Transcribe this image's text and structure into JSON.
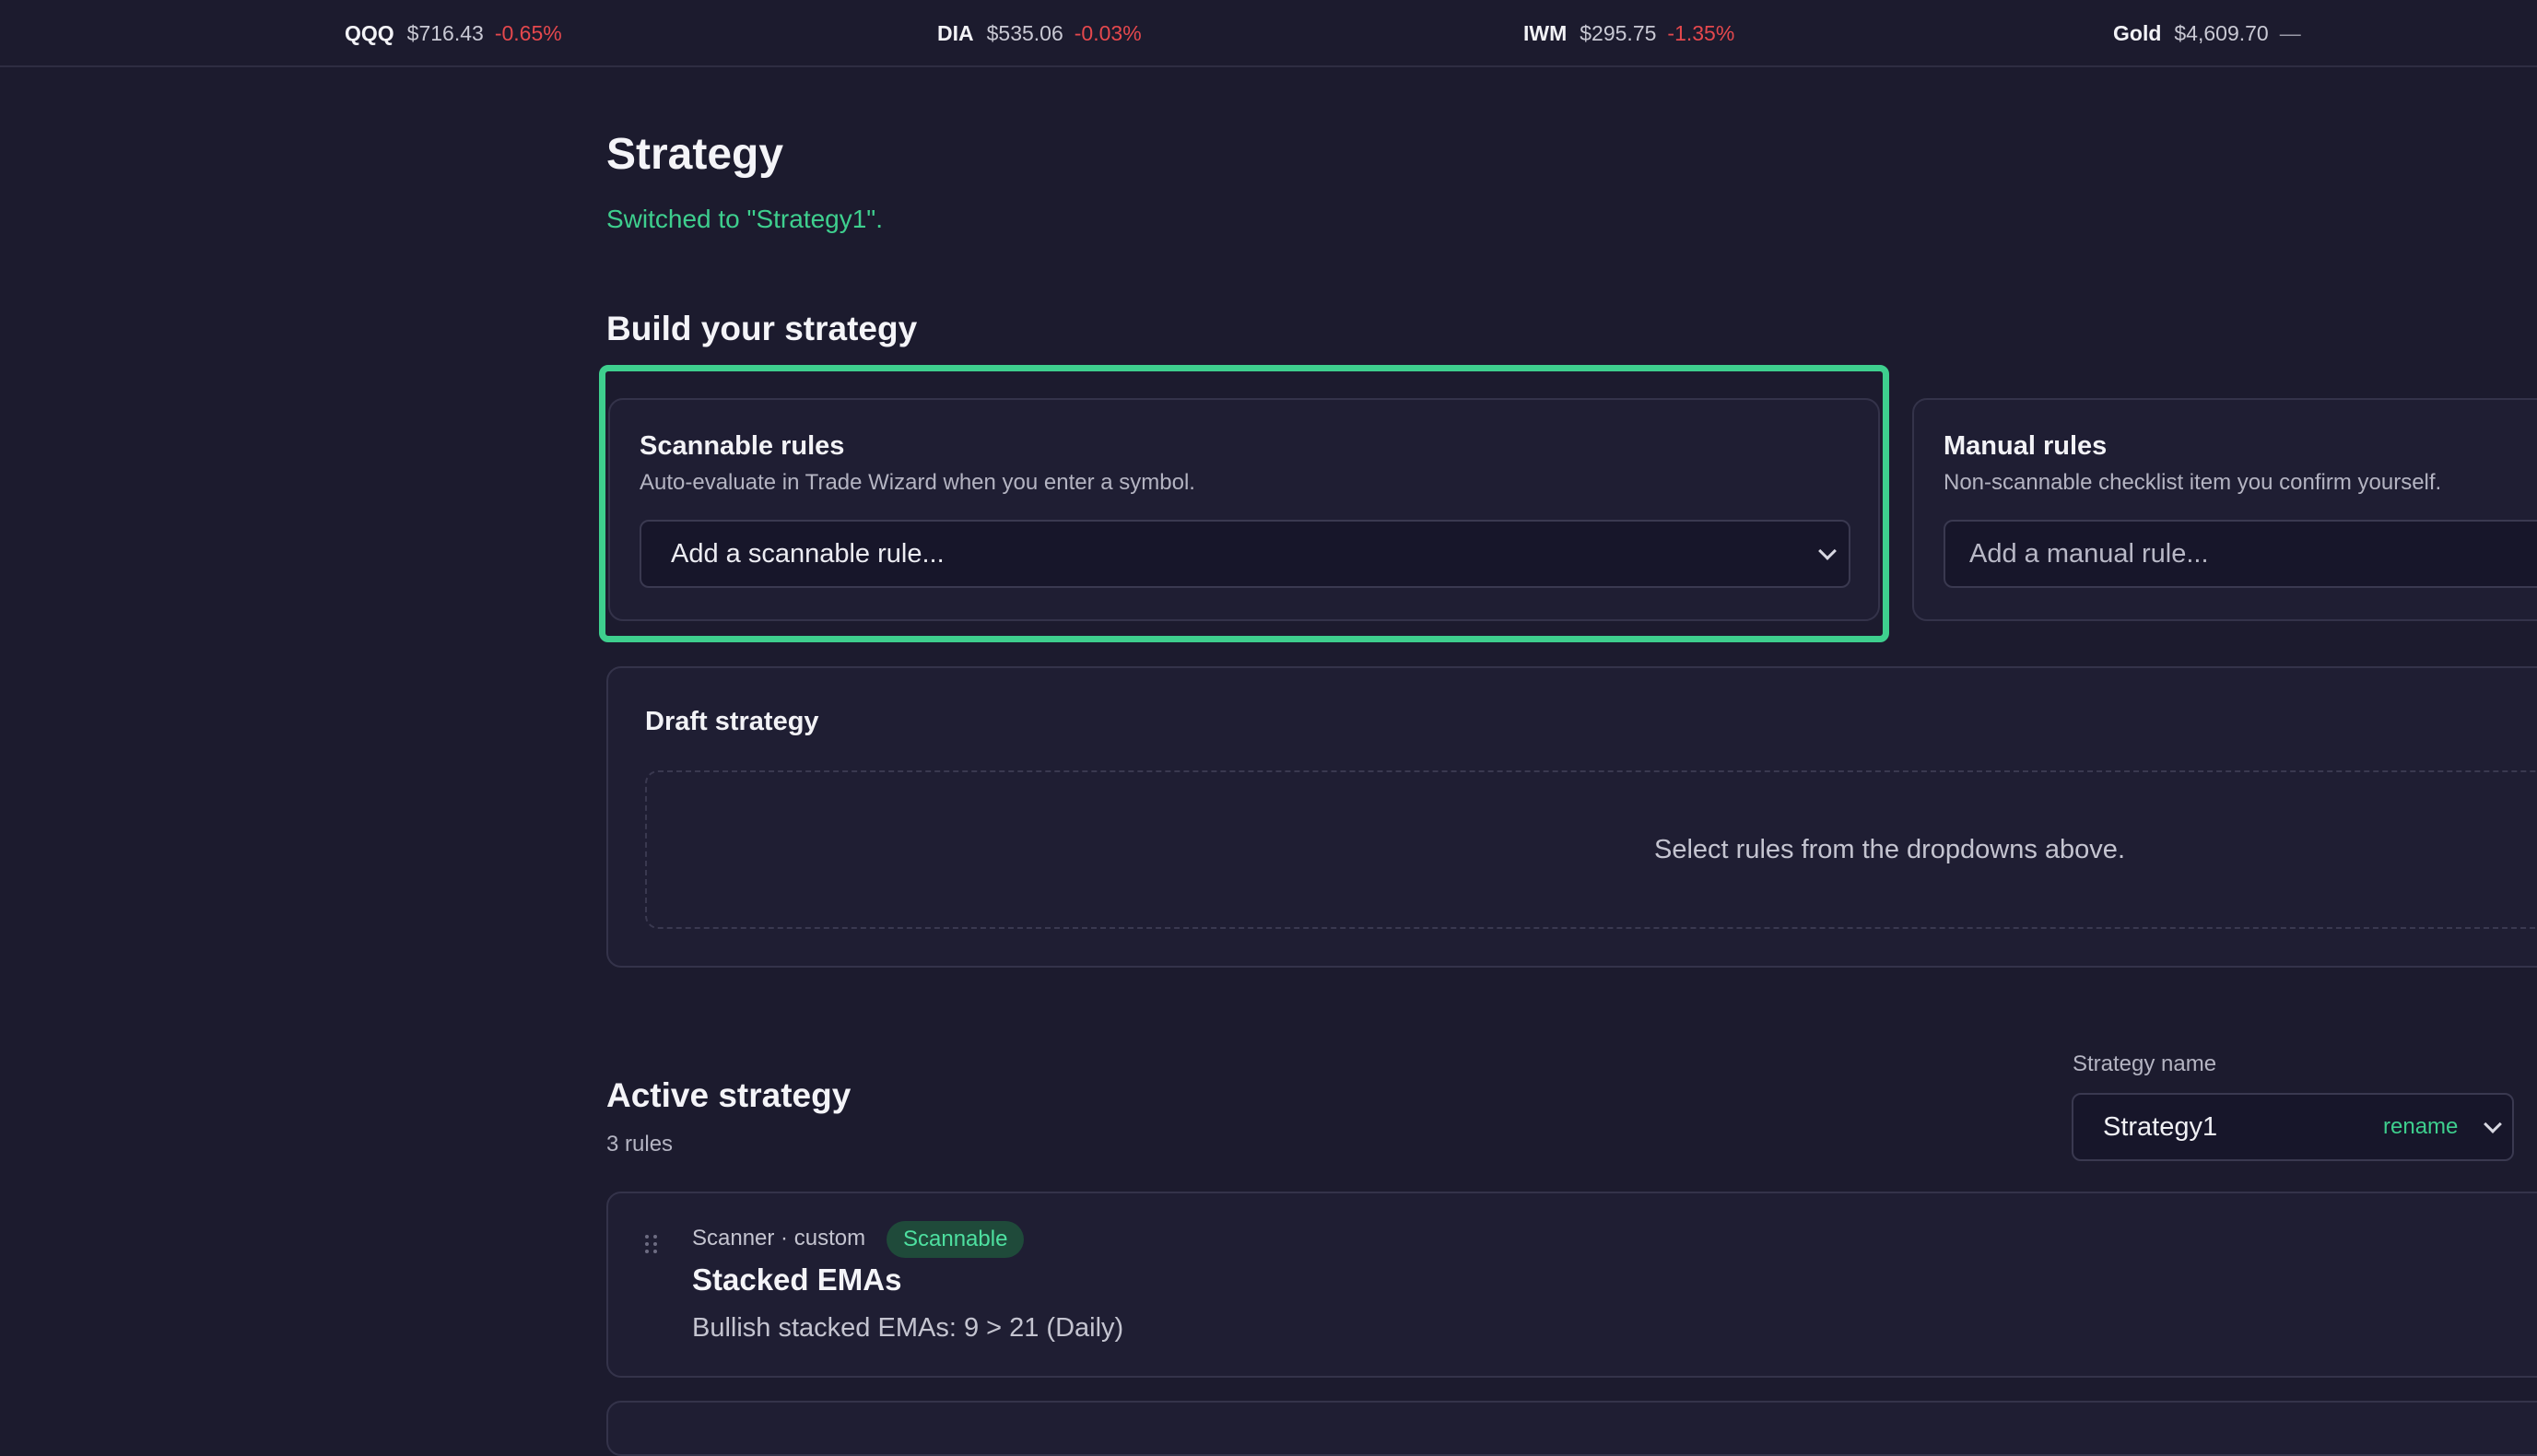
{
  "ticker": [
    {
      "symbol": "QQQ",
      "price": "$716.43",
      "change": "-0.65%",
      "direction": "down"
    },
    {
      "symbol": "DIA",
      "price": "$535.06",
      "change": "-0.03%",
      "direction": "down"
    },
    {
      "symbol": "IWM",
      "price": "$295.75",
      "change": "-1.35%",
      "direction": "down"
    },
    {
      "symbol": "Gold",
      "price": "$4,609.70",
      "change": "—",
      "direction": "flat"
    }
  ],
  "page": {
    "title": "Strategy",
    "status": "Switched to \"Strategy1\"."
  },
  "build": {
    "heading": "Build your strategy",
    "scannable": {
      "title": "Scannable rules",
      "subtitle": "Auto-evaluate in Trade Wizard when you enter a symbol.",
      "placeholder": "Add a scannable rule..."
    },
    "manual": {
      "title": "Manual rules",
      "subtitle": "Non-scannable checklist item you confirm yourself.",
      "placeholder": "Add a manual rule..."
    },
    "draft": {
      "title": "Draft strategy",
      "empty_text": "Select rules from the dropdowns above."
    }
  },
  "active": {
    "heading": "Active strategy",
    "rule_count": "3 rules",
    "name_label": "Strategy name",
    "name_value": "Strategy1",
    "rename_label": "rename",
    "rules": [
      {
        "meta": "Scanner · custom",
        "badge": "Scannable",
        "title": "Stacked EMAs",
        "description": "Bullish stacked EMAs: 9 > 21 (Daily)"
      }
    ]
  },
  "colors": {
    "background": "#1c1b2e",
    "card": "#1f1e33",
    "accent_green": "#3ecf8e",
    "negative_red": "#e5484d"
  },
  "icons": {
    "dropdown": "chevron-down-icon",
    "drag": "drag-handle-icon"
  }
}
